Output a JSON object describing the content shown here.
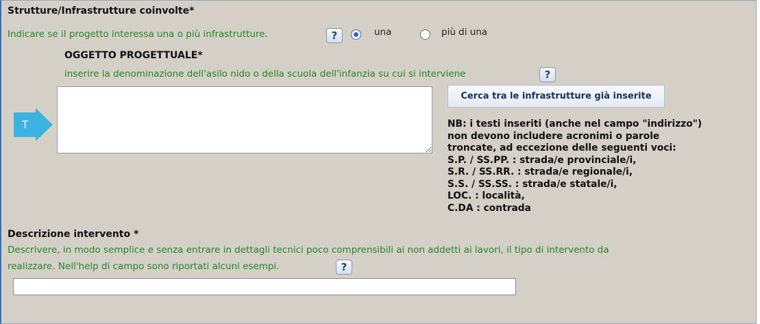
{
  "strutture": {
    "title": "Strutture/Infrastrutture coinvolte*",
    "instruction": "Indicare se il progetto interessa una o più infrastrutture.",
    "help_icon": "?",
    "options": [
      {
        "label": "una",
        "selected": true
      },
      {
        "label": "più di una",
        "selected": false
      }
    ]
  },
  "oggetto": {
    "title": "OGGETTO PROGETTUALE*",
    "instruction": "inserire la denominazione dell'asilo nido o della scuola dell'infanzia su cui si interviene",
    "help_icon": "?",
    "value": "",
    "t_marker": "T",
    "search_button": "Cerca tra le infrastrutture già inserite"
  },
  "nb": {
    "lines": [
      "NB: i testi inseriti (anche nel campo \"indirizzo\")",
      "non devono includere acronimi o parole",
      "troncate, ad eccezione delle seguenti voci:",
      "S.P. / SS.PP. : strada/e provinciale/i,",
      "S.R. / SS.RR. : strada/e regionale/i,",
      "S.S. / SS.SS. : strada/e statale/i,",
      "LOC. : località,",
      "C.DA : contrada"
    ]
  },
  "descrizione": {
    "title": "Descrizione intervento *",
    "instruction_line1": "Descrivere, in modo semplice e senza entrare in dettagli tecnici poco comprensibili ai non addetti ai lavori, il tipo di intervento da",
    "instruction_line2": "realizzare. Nell'help di campo sono riportati alcuni esempi.",
    "help_icon": "?",
    "value": ""
  },
  "colors": {
    "panel_bg": "#d4d0c8",
    "instruction_green": "#1e8a1e",
    "arrow_blue": "#3bb2df",
    "radio_blue": "#2e67c7"
  }
}
